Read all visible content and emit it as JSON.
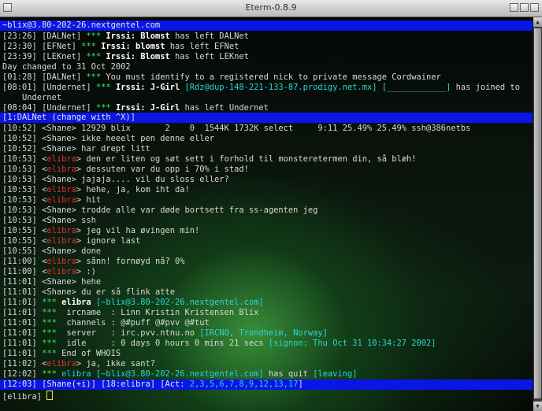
{
  "window": {
    "title": "Eterm-0.8.9"
  },
  "topic": "~blix@3.80-202-26.nextgentel.com",
  "lines": [
    {
      "time": "[23:26]",
      "net": "[DALNet]",
      "stars": "***",
      "nick": "Irssi: Blomst",
      "rest": " has left DALNet"
    },
    {
      "time": "[23:30]",
      "net": "[EFNet]",
      "stars": "***",
      "nick": "Irssi: blomst",
      "rest": " has left EFNet"
    },
    {
      "time": "[23:39]",
      "net": "[LEKnet]",
      "stars": "***",
      "nick": "Irssi: Blomst",
      "rest": " has left LEKnet"
    },
    {
      "plain": "Day changed to 31 Oct 2002"
    },
    {
      "time": "[01:28]",
      "net": "[DALNet]",
      "stars": "***",
      "rest": " You must identify to a registered nick to private message Cordwainer"
    },
    {
      "time": "[08:01]",
      "net": "[Undernet]",
      "stars": "***",
      "nick": "Irssi: J-Girl",
      "host": " [Rdz@dup-148-221-133-87.prodigy.net.mx]",
      "box": " [____________]",
      "rest": " has joined to"
    },
    {
      "plain": "    Undernet"
    },
    {
      "time": "[08:04]",
      "net": "[Undernet]",
      "stars": "***",
      "nick": "Irssi: J-Girl",
      "rest": " has left Undernet"
    }
  ],
  "window_bar": "[1:DALNet (change with ^X)]",
  "chat": [
    {
      "time": "[10:52]",
      "who": "Shane",
      "text": "12929 blix       2    0  1544K 1732K select     9:11 25.49% 25.49% ssh@386netbs"
    },
    {
      "time": "[10:52]",
      "who": "Shane",
      "text": "ikke heeelt pen denne eller"
    },
    {
      "time": "[10:52]",
      "who": "Shane",
      "text": "har drept litt"
    },
    {
      "time": "[10:53]",
      "who": "elibra",
      "text": "den er liten og søt sett i forhold til monsteretermen din, så blæh!"
    },
    {
      "time": "[10:53]",
      "who": "elibra",
      "text": "dessuten var du opp i 70% i stad!"
    },
    {
      "time": "[10:53]",
      "who": "Shane",
      "text": "jajaja.... vil du sloss eller?"
    },
    {
      "time": "[10:53]",
      "who": "elibra",
      "text": "hehe, ja, kom iht da!"
    },
    {
      "time": "[10:53]",
      "who": "elibra",
      "text": "hit"
    },
    {
      "time": "[10:53]",
      "who": "Shane",
      "text": "trodde alle var døde bortsett fra ss-agenten jeg"
    },
    {
      "time": "[10:53]",
      "who": "Shane",
      "text": "ssh"
    },
    {
      "time": "[10:55]",
      "who": "elibra",
      "text": "jeg vil ha øvingen min!"
    },
    {
      "time": "[10:55]",
      "who": "elibra",
      "text": "ignore last"
    },
    {
      "time": "[10:55]",
      "who": "Shane",
      "text": "done"
    },
    {
      "time": "[11:00]",
      "who": "elibra",
      "text": "sånn! fornøyd nå? 0%"
    },
    {
      "time": "[11:00]",
      "who": "elibra",
      "text": ":)"
    },
    {
      "time": "[11:01]",
      "who": "Shane",
      "text": "hehe"
    },
    {
      "time": "[11:01]",
      "who": "Shane",
      "text": "du er så flink atte"
    }
  ],
  "whois": {
    "time": "[11:01]",
    "nick": "elibra",
    "host": "[~blix@3.80-202-26.nextgentel.com]",
    "ircname_label": "ircname  : ",
    "ircname": "Linn Kristin Kristensen Blix",
    "channels_label": "channels : ",
    "channels": "@#puff @#pvv @#tut",
    "server_label": "server   : ",
    "server": "irc.pvv.ntnu.no",
    "server_extra": " [IRCNO, Trondheim, Norway]",
    "idle_label": "idle     : ",
    "idle": "0 days 0 hours 0 mins 21 secs",
    "signon": " [signon: Thu Oct 31 10:34:27 2002]",
    "end": "End of WHOIS"
  },
  "after": [
    {
      "time": "[11:02]",
      "who": "elibra",
      "text": "ja, ikke sant?"
    }
  ],
  "quit": {
    "time": "[12:02]",
    "nick": "elibra",
    "host": "[~blix@3.80-202-26.nextgentel.com]",
    "rest": " has quit ",
    "reason": "[leaving]"
  },
  "status": {
    "time": "[12:03]",
    "me": "[Shane(+i)]",
    "win": "[18:elibra]",
    "act_label": "[Act: ",
    "act": "2,3,5,6,7,8,9,12,13,17",
    "act_end": "]"
  },
  "prompt": {
    "label": "[elibra]"
  },
  "stars": "***"
}
